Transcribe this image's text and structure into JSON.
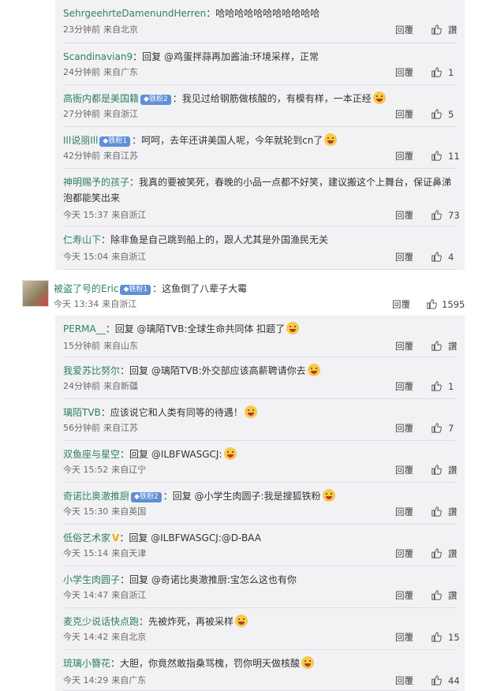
{
  "group1": [
    {
      "user": "SehrgeehrteDamenundHerren",
      "sep": "：",
      "text": "哈哈哈哈哈哈哈哈哈哈哈",
      "time": "23分钟前",
      "loc": "来自北京",
      "reply": "回覆",
      "likes": "讚"
    },
    {
      "user": "Scandinavian9",
      "sep": "：",
      "text": "回复 @鸡蛋拌蒜再加酱油:环境采样，正常",
      "time": "24分钟前",
      "loc": "来自广东",
      "reply": "回覆",
      "likes": "1"
    },
    {
      "user": "高衙内都是美国籍",
      "badge": "铁粉2",
      "sep": "：",
      "text": "我见过给钢筋做核酸的，有模有样，一本正经",
      "emoji": true,
      "time": "27分钟前",
      "loc": "来自浙江",
      "reply": "回覆",
      "likes": "5"
    },
    {
      "user": "Ill说丽Ill",
      "badge": "铁粉1",
      "sep": "：",
      "text": "呵呵，去年还讲美国人呢，今年就轮到cn了",
      "emoji": true,
      "time": "42分钟前",
      "loc": "来自江苏",
      "reply": "回覆",
      "likes": "11"
    },
    {
      "user": "神明赐予的孩子",
      "sep": "：",
      "text": "我真的要被笑死，春晚的小品一点都不好笑，建议搬这个上舞台，保证鼻涕",
      "text2": "泡都能笑出来",
      "time": "今天 15:37",
      "loc": "来自浙江",
      "reply": "回覆",
      "likes": "73"
    },
    {
      "user": "仁寿山下",
      "sep": "：",
      "text": "除非鱼是自己跳到船上的，跟人尤其是外国渔民无关",
      "time": "今天 15:04",
      "loc": "来自浙江",
      "reply": "回覆",
      "likes": "4"
    }
  ],
  "top": {
    "user": "被盗了号的Eric",
    "badge": "铁粉1",
    "sep": "：",
    "text": "这鱼倒了八辈子大霉",
    "time": "今天 13:34",
    "loc": "来自浙江",
    "reply": "回覆",
    "likes": "1595"
  },
  "group2": [
    {
      "user": "PERMA__",
      "sep": "：",
      "text": "回复 @璃陌TVB:全球生命共同体 扣题了",
      "emoji": true,
      "time": "15分钟前",
      "loc": "来自山东",
      "reply": "回覆",
      "likes": "讚"
    },
    {
      "user": "我爱苏比努尔",
      "sep": "：",
      "text": "回复 @璃陌TVB:外交部应该高薪聘请你去",
      "emoji": true,
      "time": "24分钟前",
      "loc": "来自新疆",
      "reply": "回覆",
      "likes": "1"
    },
    {
      "user": "璃陌TVB",
      "sep": "：",
      "text": "应该说它和人类有同等的待遇！",
      "emoji": true,
      "time": "56分钟前",
      "loc": "来自江苏",
      "reply": "回覆",
      "likes": "7"
    },
    {
      "user": "双鱼座与星空",
      "sep": "：",
      "text": "回复 @ILBFWASGCJ:",
      "emoji": true,
      "time": "今天 15:52",
      "loc": "来自辽宁",
      "reply": "回覆",
      "likes": "讚"
    },
    {
      "user": "奇诺比奥澈推厨",
      "badge": "铁粉2",
      "sep": "：",
      "text": "回复 @小学生肉圆子:我是搜狐铁粉",
      "emoji": true,
      "time": "今天 15:30",
      "loc": "来自英国",
      "reply": "回覆",
      "likes": "讚"
    },
    {
      "user": "低俗艺术家",
      "vip": "V",
      "sep": "：",
      "text": "回复 @ILBFWASGCJ:@D-BAA",
      "time": "今天 15:14",
      "loc": "来自天津",
      "reply": "回覆",
      "likes": "讚"
    },
    {
      "user": "小学生肉圆子",
      "sep": "：",
      "text": "回复 @奇诺比奥澈推厨:宝怎么这也有你",
      "time": "今天 14:47",
      "loc": "来自浙江",
      "reply": "回覆",
      "likes": "讚"
    },
    {
      "user": "麦克少说话快点跑",
      "sep": "：",
      "text": "先被炸死，再被采样",
      "emoji": true,
      "time": "今天 14:42",
      "loc": "来自北京",
      "reply": "回覆",
      "likes": "15"
    },
    {
      "user": "琉璃小簪花",
      "sep": "：",
      "text": "大胆，你竟然敢指桑骂槐，罚你明天做核酸",
      "emoji": true,
      "time": "今天 14:29",
      "loc": "来自广东",
      "reply": "回覆",
      "likes": "44"
    }
  ]
}
